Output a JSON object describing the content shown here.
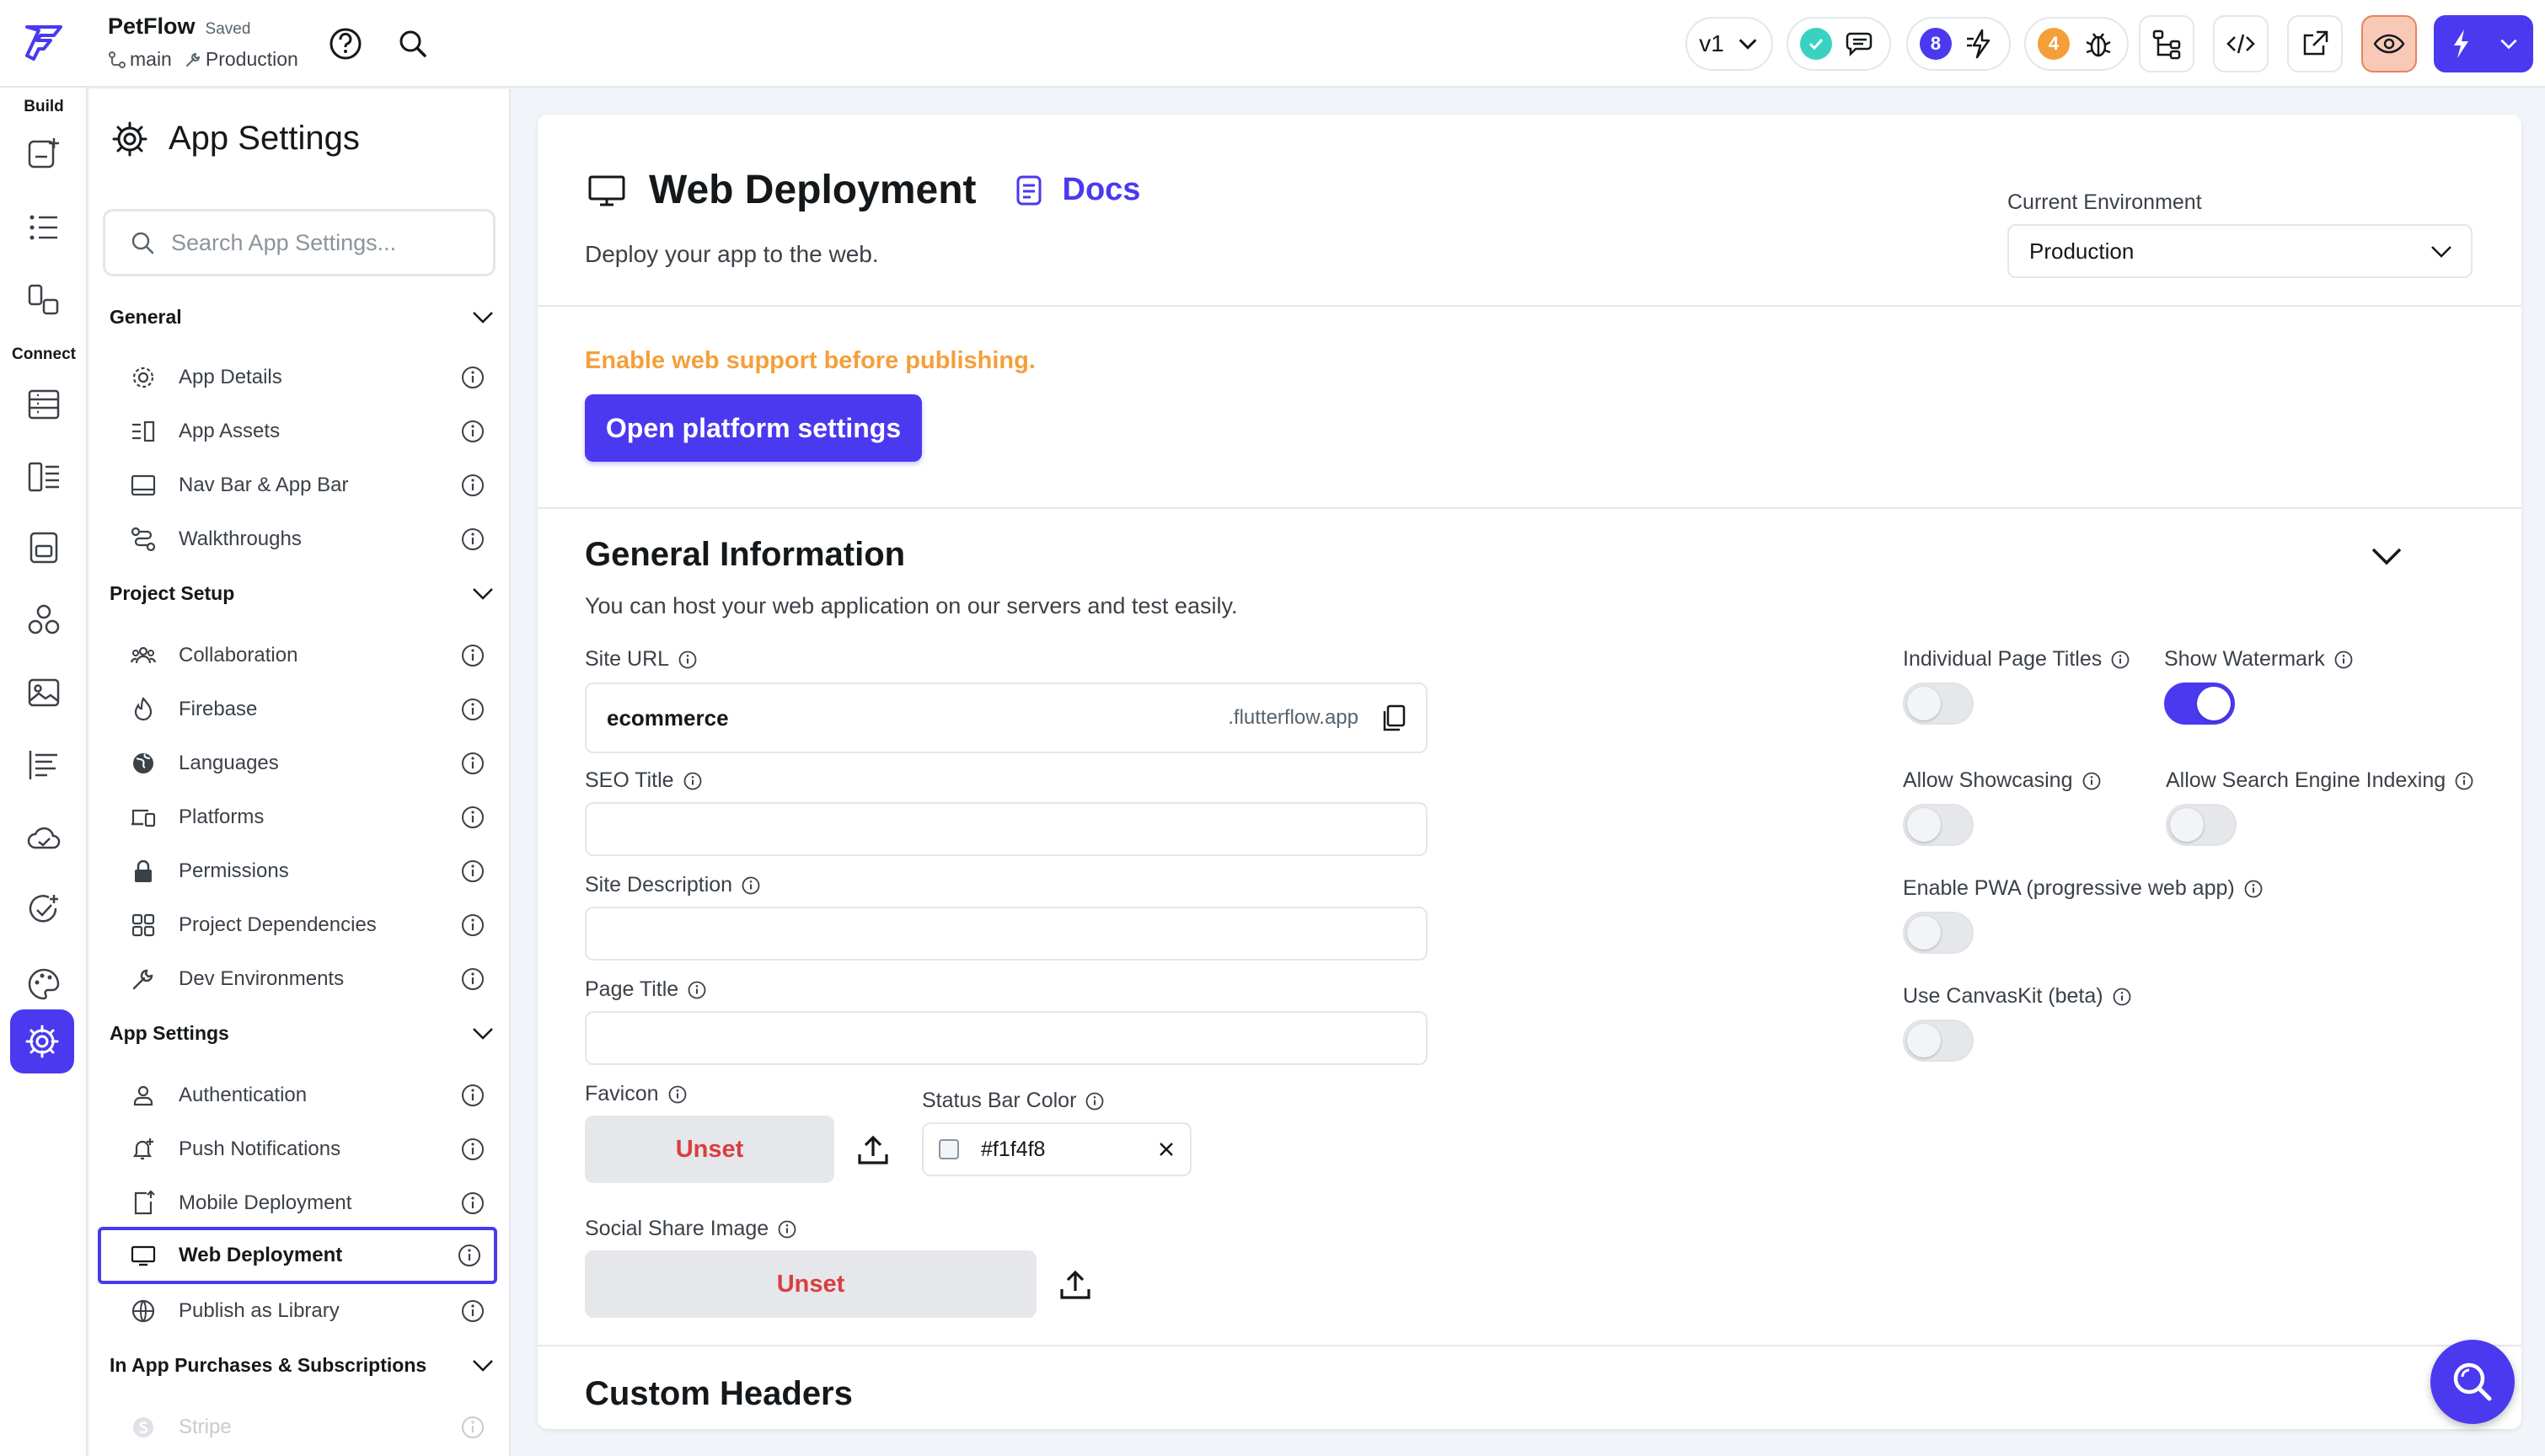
{
  "topbar": {
    "project_name": "PetFlow",
    "saved_status": "Saved",
    "branch": "main",
    "environment": "Production",
    "version": "v1",
    "comments_badge": "8",
    "issues_badge": "4"
  },
  "rail": {
    "build_label": "Build",
    "connect_label": "Connect"
  },
  "sidebar": {
    "title": "App Settings",
    "search_placeholder": "Search App Settings...",
    "sections": {
      "general": "General",
      "project_setup": "Project Setup",
      "app_settings": "App Settings",
      "iap": "In App Purchases & Subscriptions"
    },
    "items": [
      {
        "label": "App Details"
      },
      {
        "label": "App Assets"
      },
      {
        "label": "Nav Bar & App Bar"
      },
      {
        "label": "Walkthroughs"
      },
      {
        "label": "Collaboration"
      },
      {
        "label": "Firebase"
      },
      {
        "label": "Languages"
      },
      {
        "label": "Platforms"
      },
      {
        "label": "Permissions"
      },
      {
        "label": "Project Dependencies"
      },
      {
        "label": "Dev Environments"
      },
      {
        "label": "Authentication"
      },
      {
        "label": "Push Notifications"
      },
      {
        "label": "Mobile Deployment"
      },
      {
        "label": "Web Deployment"
      },
      {
        "label": "Publish as Library"
      },
      {
        "label": "Stripe"
      }
    ]
  },
  "main": {
    "title": "Web Deployment",
    "docs_label": "Docs",
    "subtitle": "Deploy your app to the web.",
    "env_label": "Current Environment",
    "env_value": "Production",
    "warning": "Enable web support before publishing.",
    "open_platform_btn": "Open platform settings",
    "general_title": "General Information",
    "general_subtitle": "You can host your web application on our servers and test easily.",
    "site_url_label": "Site URL",
    "site_url_value": "ecommerce",
    "site_url_suffix": ".flutterflow.app",
    "seo_title_label": "SEO Title",
    "site_desc_label": "Site Description",
    "page_title_label": "Page Title",
    "favicon_label": "Favicon",
    "favicon_value": "Unset",
    "status_bar_label": "Status Bar Color",
    "status_bar_value": "#f1f4f8",
    "social_share_label": "Social Share Image",
    "social_share_value": "Unset",
    "toggles": {
      "individual_page_titles": {
        "label": "Individual Page Titles",
        "on": false
      },
      "show_watermark": {
        "label": "Show Watermark",
        "on": true
      },
      "allow_showcasing": {
        "label": "Allow Showcasing",
        "on": false
      },
      "allow_search_engine": {
        "label": "Allow Search Engine Indexing",
        "on": false
      },
      "enable_pwa": {
        "label": "Enable PWA (progressive web app)",
        "on": false
      },
      "use_canvaskit": {
        "label": "Use CanvasKit (beta)",
        "on": false
      }
    },
    "custom_headers_title": "Custom Headers"
  },
  "colors": {
    "accent": "#4b39ef",
    "warning": "#f59f3a",
    "danger": "#d93e3e",
    "success": "#39d2c0",
    "issues_badge": "#f59f3a"
  }
}
